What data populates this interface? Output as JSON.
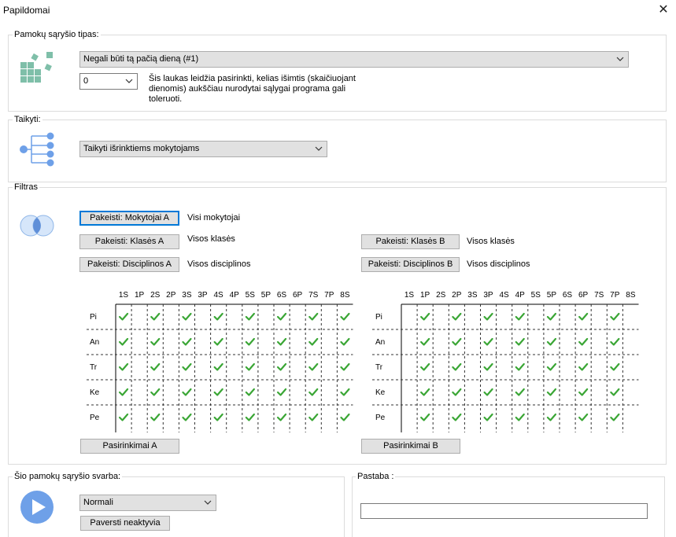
{
  "window": {
    "title": "Papildomai",
    "close_icon": "close-icon"
  },
  "relation_type": {
    "legend": "Pamokų sąryšio tipas:",
    "selected": "Negali būti tą pačią dieną (#1)",
    "tolerance_value": "0",
    "help_text_lines": [
      "Šis laukas leidžia pasirinkti, kelias išimtis (skaičiuojant",
      "dienomis) aukščiau nurodytai sąlygai programa gali",
      "toleruoti."
    ]
  },
  "apply": {
    "legend": "Taikyti:",
    "selected": "Taikyti išrinktiems mokytojams"
  },
  "filter": {
    "legend": "Filtras",
    "teachers_a_button": "Pakeisti: Mokytojai A",
    "teachers_a_value": "Visi mokytojai",
    "classes_a_button": "Pakeisti: Klasės A",
    "classes_a_value": "Visos klasės",
    "subjects_a_button": "Pakeisti: Disciplinos A",
    "subjects_a_value": "Visos disciplinos",
    "classes_b_button": "Pakeisti: Klasės B",
    "classes_b_value": "Visos klasės",
    "subjects_b_button": "Pakeisti: Disciplinos B",
    "subjects_b_value": "Visos disciplinos",
    "periods": [
      "1S",
      "1P",
      "2S",
      "2P",
      "3S",
      "3P",
      "4S",
      "4P",
      "5S",
      "5P",
      "6S",
      "6P",
      "7S",
      "7P",
      "8S"
    ],
    "days": [
      "Pi",
      "An",
      "Tr",
      "Ke",
      "Pe"
    ],
    "grid_a_checked_columns": [
      0,
      2,
      4,
      6,
      8,
      10,
      12,
      14
    ],
    "grid_b_checked_columns": [
      1,
      3,
      5,
      7,
      9,
      11,
      13
    ],
    "check_color": "#3aa635",
    "choices_a_button": "Pasirinkimai A",
    "choices_b_button": "Pasirinkimai B"
  },
  "importance": {
    "legend": "Šio pamokų sąryšio svarba:",
    "selected": "Normali",
    "deactivate_button": "Paversti neaktyvia",
    "accent": "#6ea0e8"
  },
  "note": {
    "legend": "Pastaba :",
    "value": ""
  }
}
